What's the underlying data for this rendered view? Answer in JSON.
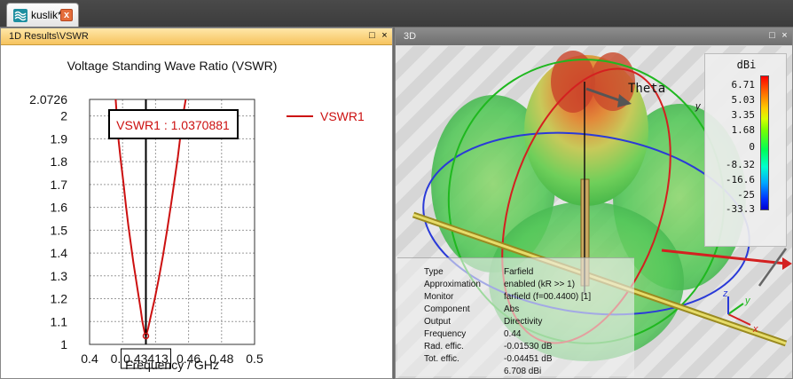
{
  "document_tab": {
    "title": "kuslik*",
    "close_glyph": "x"
  },
  "left_panel": {
    "title": "1D Results\\VSWR",
    "restore_glyph": "□",
    "close_glyph": "×"
  },
  "right_panel": {
    "title": "3D",
    "restore_glyph": "□",
    "close_glyph": "×"
  },
  "chart_data": {
    "type": "line",
    "title": "Voltage Standing Wave Ratio (VSWR)",
    "xlabel": "Frequency / GHz",
    "ylabel": "",
    "xlim": [
      0.4,
      0.5
    ],
    "ylim": [
      1,
      2.0726
    ],
    "xticks": [
      "0.4",
      "0.42",
      "0.44",
      "0.46",
      "0.48",
      "0.5"
    ],
    "yticks": [
      "2.0726",
      "2",
      "1.9",
      "1.8",
      "1.7",
      "1.6",
      "1.5",
      "1.4",
      "1.3",
      "1.2",
      "1.1",
      "1"
    ],
    "grid": true,
    "legend_position": "top-right",
    "series": [
      {
        "name": "VSWR1",
        "color": "#cc1010",
        "x": [
          0.4158,
          0.4175,
          0.419,
          0.4205,
          0.422,
          0.4235,
          0.425,
          0.4265,
          0.428,
          0.4295,
          0.431,
          0.432,
          0.4333,
          0.43413,
          0.4355,
          0.437,
          0.4395,
          0.442,
          0.4445,
          0.447,
          0.4495,
          0.4515,
          0.4535,
          0.455,
          0.4565,
          0.4583
        ],
        "y": [
          2.0726,
          1.9,
          1.8,
          1.71,
          1.61,
          1.52,
          1.44,
          1.36,
          1.29,
          1.22,
          1.15,
          1.1,
          1.055,
          1.037,
          1.07,
          1.12,
          1.2,
          1.29,
          1.39,
          1.5,
          1.62,
          1.72,
          1.82,
          1.91,
          2.0,
          2.0726
        ]
      }
    ],
    "marker": {
      "x": 0.43413,
      "x_label": "0.43413",
      "readout": "VSWR1 : 1.0370881"
    }
  },
  "farfield_view": {
    "theta_label": "Theta",
    "axis_y_label": "y",
    "colorbar": {
      "unit": "dBi",
      "labels": [
        "6.71",
        "5.03",
        "3.35",
        "1.68",
        "0",
        "-8.32",
        "-16.6",
        "-25",
        "-33.3"
      ]
    },
    "triad": {
      "x": "x",
      "y": "y",
      "z": "z"
    },
    "info": [
      {
        "key": "Type",
        "value": "Farfield"
      },
      {
        "key": "Approximation",
        "value": "enabled (kR >> 1)"
      },
      {
        "key": "Monitor",
        "value": "farfield (f=00.4400) [1]"
      },
      {
        "key": "Component",
        "value": "Abs"
      },
      {
        "key": "Output",
        "value": "Directivity"
      },
      {
        "key": "Frequency",
        "value": "0.44"
      },
      {
        "key": "Rad. effic.",
        "value": "-0.01530 dB"
      },
      {
        "key": "Tot. effic.",
        "value": "-0.04451 dB"
      },
      {
        "key": "",
        "value": "6.708 dBi"
      }
    ]
  }
}
